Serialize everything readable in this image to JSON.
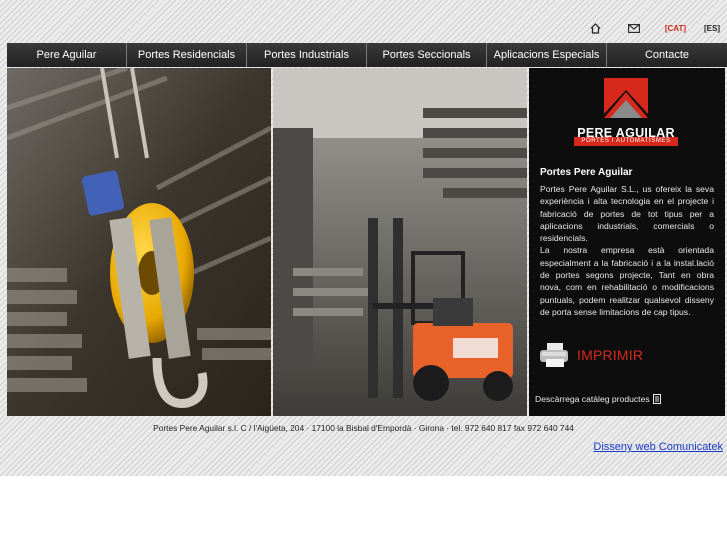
{
  "colors": {
    "accent": "#d6281b",
    "nav_bg": "#2b2b2b",
    "panel_bg": "#0d0d0d",
    "link": "#1a3cc8"
  },
  "topbar": {
    "icons": [
      "home-icon",
      "mail-icon"
    ],
    "lang_cat": "[CAT]",
    "lang_es": "[ES]"
  },
  "nav": {
    "items": [
      {
        "label": "Pere Aguilar"
      },
      {
        "label": "Portes Residencials"
      },
      {
        "label": "Portes Industrials"
      },
      {
        "label": "Portes Seccionals"
      },
      {
        "label": "Aplicacions Especials"
      },
      {
        "label": "Contacte"
      }
    ]
  },
  "logo": {
    "name": "PERE AGUILAR",
    "tagline": "PORTES I AUTOMATISMES"
  },
  "panel": {
    "title": "Portes Pere Aguilar",
    "paragraph1": "Portes Pere Aguilar S.L., us ofereix la seva experiència i alta tecnologia en el projecte i fabricació de portes de tot tipus per a aplicacions industrials, comercials o residencials.",
    "paragraph2": "La nostra empresa està orientada especialment a la fabricació i a la instal.lació de portes segons projecte, Tant en obra nova, com en rehabilitació o modificacions puntuals, podem realitzar qualsevol disseny de porta sense limitacions de cap tipus.",
    "print_label": "IMPRIMIR",
    "catalog_label": "Descàrrega catàleg productes"
  },
  "footer": {
    "address": "Portes Pere Aguilar s.l. C / l'Aigüeta, 204 · 17100 la Bisbal d'Empordà · Girona · tel. 972 640 817 fax 972 640 744",
    "credits": "Disseny web Comunicatek"
  }
}
